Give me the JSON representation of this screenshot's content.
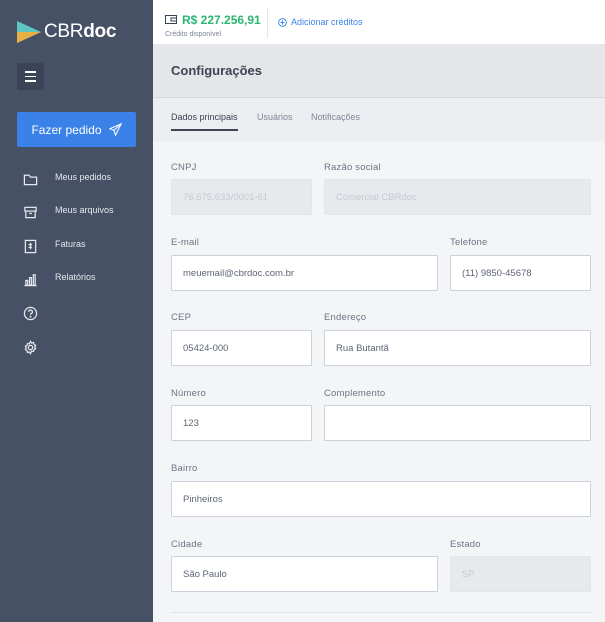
{
  "brand": {
    "name_light": "CBR",
    "name_bold": "doc"
  },
  "sidebar": {
    "order_button": "Fazer pedido",
    "items": [
      {
        "label": "Meus pedidos",
        "icon": "folder-icon"
      },
      {
        "label": "Meus arquivos",
        "icon": "archive-icon"
      },
      {
        "label": "Faturas",
        "icon": "invoice-icon"
      },
      {
        "label": "Relatórios",
        "icon": "chart-icon"
      },
      {
        "label": "",
        "icon": "help-icon"
      },
      {
        "label": "",
        "icon": "gear-icon"
      }
    ]
  },
  "topbar": {
    "credit_value": "R$ 227.256,91",
    "credit_label": "Crédito disponível",
    "add_credit": "Adicionar créditos"
  },
  "page": {
    "title": "Configurações"
  },
  "tabs": [
    "Dados principais",
    "Usuários",
    "Notificações"
  ],
  "form": {
    "cnpj": {
      "label": "CNPJ",
      "value": "76.675.633/0001-61"
    },
    "razao": {
      "label": "Razão social",
      "value": "Comercial CBRdoc"
    },
    "email": {
      "label": "E-mail",
      "value": "meuemail@cbrdoc.com.br"
    },
    "telefone": {
      "label": "Telefone",
      "value": "(11) 9850-45678"
    },
    "cep": {
      "label": "CEP",
      "value": "05424-000"
    },
    "endereco": {
      "label": "Endereço",
      "value": "Rua Butantã"
    },
    "numero": {
      "label": "Número",
      "value": "123"
    },
    "complemento": {
      "label": "Complemento",
      "value": ""
    },
    "bairro": {
      "label": "Bairro",
      "value": "Pinheiros"
    },
    "cidade": {
      "label": "Cidade",
      "value": "São Paulo"
    },
    "estado": {
      "label": "Estado",
      "value": "SP"
    }
  },
  "colors": {
    "sidebar": "#475166",
    "accent": "#3b82e8",
    "credit": "#2bb673",
    "logo_mark": "#5ec5c2"
  }
}
